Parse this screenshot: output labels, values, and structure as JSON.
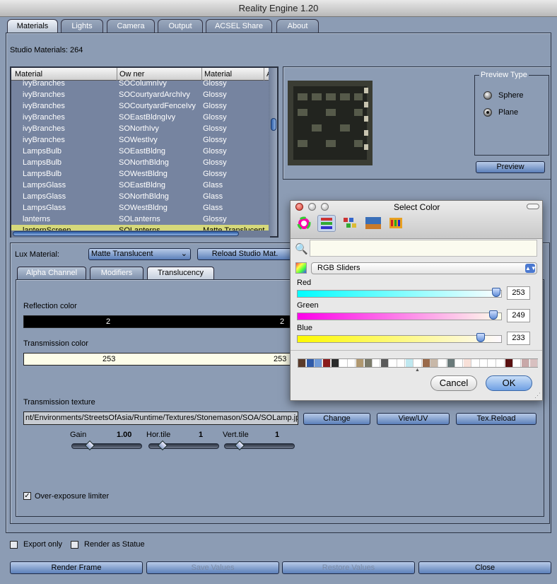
{
  "window_title": "Reality Engine 1.20",
  "tabs": [
    "Materials",
    "Lights",
    "Camera",
    "Output",
    "ACSEL Share",
    "About"
  ],
  "studio_materials": "Studio Materials: 264",
  "table": {
    "headers": [
      "Material",
      "Ow ner",
      "Material",
      "A"
    ],
    "rows": [
      [
        "ivyBranches",
        "SOColumnIvy",
        "Glossy"
      ],
      [
        "ivyBranches",
        "SOCourtyardArchIvy",
        "Glossy"
      ],
      [
        "ivyBranches",
        "SOCourtyardFenceIvy",
        "Glossy"
      ],
      [
        "ivyBranches",
        "SOEastBldngIvy",
        "Glossy"
      ],
      [
        "ivyBranches",
        "SONorthIvy",
        "Glossy"
      ],
      [
        "ivyBranches",
        "SOWestIvy",
        "Glossy"
      ],
      [
        "LampsBulb",
        "SOEastBldng",
        "Glossy"
      ],
      [
        "LampsBulb",
        "SONorthBldng",
        "Glossy"
      ],
      [
        "LampsBulb",
        "SOWestBldng",
        "Glossy"
      ],
      [
        "LampsGlass",
        "SOEastBldng",
        "Glass"
      ],
      [
        "LampsGlass",
        "SONorthBldng",
        "Glass"
      ],
      [
        "LampsGlass",
        "SOWestBldng",
        "Glass"
      ],
      [
        "lanterns",
        "SOLanterns",
        "Glossy"
      ],
      [
        "lanternScreen",
        "SOLanterns",
        "Matte Translucent"
      ]
    ],
    "selected_index": 13
  },
  "preview": {
    "legend": "Preview Type",
    "options": [
      "Sphere",
      "Plane"
    ],
    "selected": "Plane",
    "button": "Preview"
  },
  "lux_label": "Lux Material:",
  "lux_value": "Matte Translucent",
  "reload_button": "Reload Studio Mat.",
  "subtabs": [
    "Alpha Channel",
    "Modifiers",
    "Translucency"
  ],
  "reflection": {
    "label": "Reflection color",
    "left": "2",
    "right": "2"
  },
  "transmission": {
    "label": "Transmission color",
    "left": "253",
    "right": "253"
  },
  "texture": {
    "label": "Transmission texture",
    "path": "nt/Environments/StreetsOfAsia/Runtime/Textures/Stonemason/SOA/SOLamp.jpg",
    "change": "Change",
    "view": "View/UV",
    "reload": "Tex.Reload"
  },
  "params": {
    "gain_label": "Gain",
    "gain_value": "1.00",
    "htile_label": "Hor.tile",
    "htile_value": "1",
    "vtile_label": "Vert.tile",
    "vtile_value": "1"
  },
  "overexposure": "Over-exposure limiter",
  "export_only": "Export only",
  "render_statue": "Render as Statue",
  "bottom_buttons": [
    "Render Frame",
    "Save Values",
    "Restore Values",
    "Close"
  ],
  "dialog": {
    "title": "Select Color",
    "mode": "RGB Sliders",
    "red_label": "Red",
    "red_value": "253",
    "green_label": "Green",
    "green_value": "249",
    "blue_label": "Blue",
    "blue_value": "233",
    "cancel": "Cancel",
    "ok": "OK",
    "swatches": [
      "#5a3a2a",
      "#2f5aa8",
      "#6f9ad8",
      "#8a1c1c",
      "#2a2a2a",
      "#ffffff",
      "#ffffff",
      "#b09870",
      "#7a7a6a",
      "#ffffff",
      "#5a5a5a",
      "#ffffff",
      "#ffffff",
      "#bfe8f0",
      "#ffffff",
      "#9a6a4a",
      "#c8b8a8",
      "#ffffff",
      "#6a7a7a",
      "#ffffff",
      "#f8e0d8",
      "#ffffff",
      "#ffffff",
      "#ffffff",
      "#ffffff",
      "#5a1010",
      "#ffffff",
      "#c8a8a8",
      "#d8c0c0"
    ]
  },
  "colors": {
    "reflection": "#000000",
    "transmission": "#fdfde9",
    "accent": "#5b7fb9"
  }
}
